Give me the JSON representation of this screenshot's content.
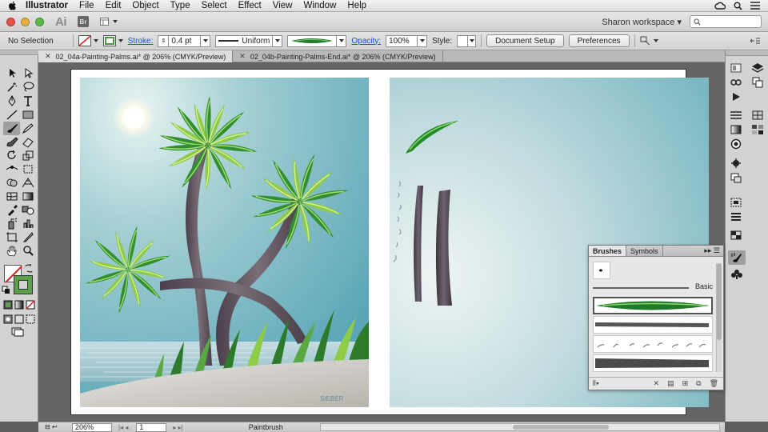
{
  "menubar": {
    "app_name": "Illustrator",
    "items": [
      "File",
      "Edit",
      "Object",
      "Type",
      "Select",
      "Effect",
      "View",
      "Window",
      "Help"
    ]
  },
  "appbar": {
    "logo": "Ai",
    "bridge": "Br",
    "workspace": "Sharon workspace"
  },
  "control": {
    "selection": "No Selection",
    "stroke_label": "Stroke:",
    "stroke_value": "0.4 pt",
    "profile": "Uniform",
    "opacity_label": "Opacity:",
    "opacity_value": "100%",
    "style_label": "Style:",
    "doc_setup": "Document Setup",
    "preferences": "Preferences"
  },
  "tabs": [
    {
      "label": "02_04a-Painting-Palms.ai* @ 206% (CMYK/Preview)"
    },
    {
      "label": "02_04b-Painting-Palms-End.ai* @ 206% (CMYK/Preview)"
    }
  ],
  "brushes_panel": {
    "tab_brushes": "Brushes",
    "tab_symbols": "Symbols",
    "basic_label": "Basic"
  },
  "status": {
    "zoom": "206%",
    "page": "1",
    "tool": "Paintbrush"
  },
  "colors": {
    "accent": "#1b56c8",
    "sky": "#6fb5c3",
    "palm_green": "#3a9a3a",
    "trunk": "#5a4e58"
  },
  "artwork": {
    "signature": "SIEBER"
  }
}
